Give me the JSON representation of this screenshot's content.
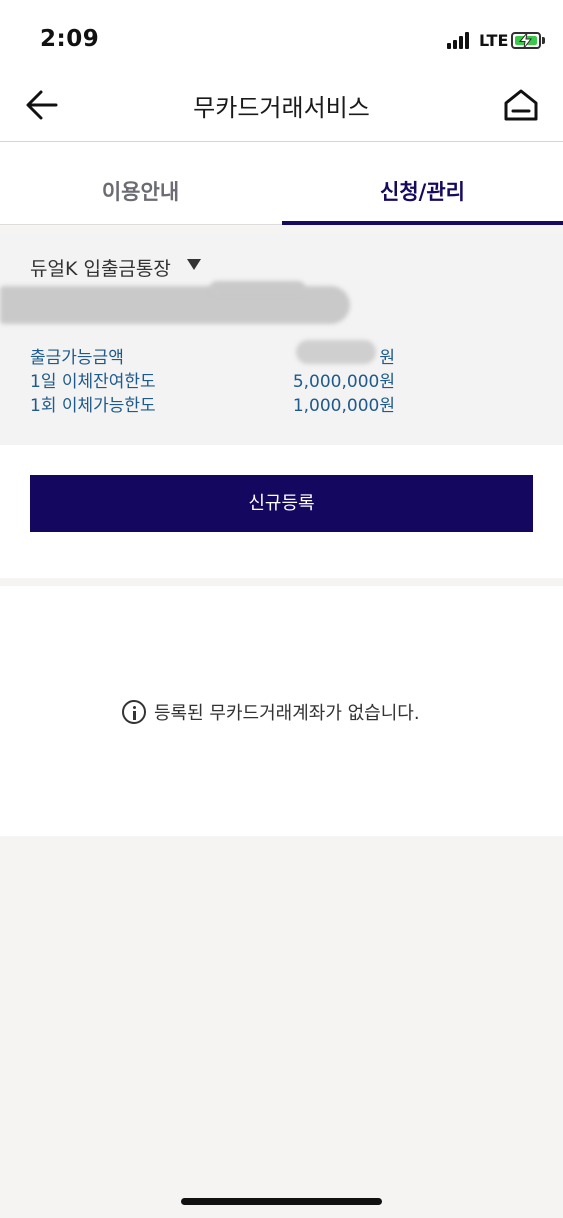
{
  "status_bar": {
    "time": "2:09",
    "network": "LTE"
  },
  "header": {
    "title": "무카드거래서비스"
  },
  "tabs": [
    {
      "label": "이용안내",
      "active": false
    },
    {
      "label": "신청/관리",
      "active": true
    }
  ],
  "account": {
    "selected_account": "듀얼K 입출금통장",
    "account_number": "",
    "rows": [
      {
        "label": "출금가능금액",
        "value": "원"
      },
      {
        "label": "1일 이체잔여한도",
        "value": "5,000,000원"
      },
      {
        "label": "1회 이체가능한도",
        "value": "1,000,000원"
      }
    ]
  },
  "register_button_label": "신규등록",
  "empty_message": "등록된 무카드거래계좌가 없습니다.",
  "colors": {
    "accent": "#130760",
    "info_text": "#1f5a8c",
    "panel_bg": "#f3f3f3"
  }
}
